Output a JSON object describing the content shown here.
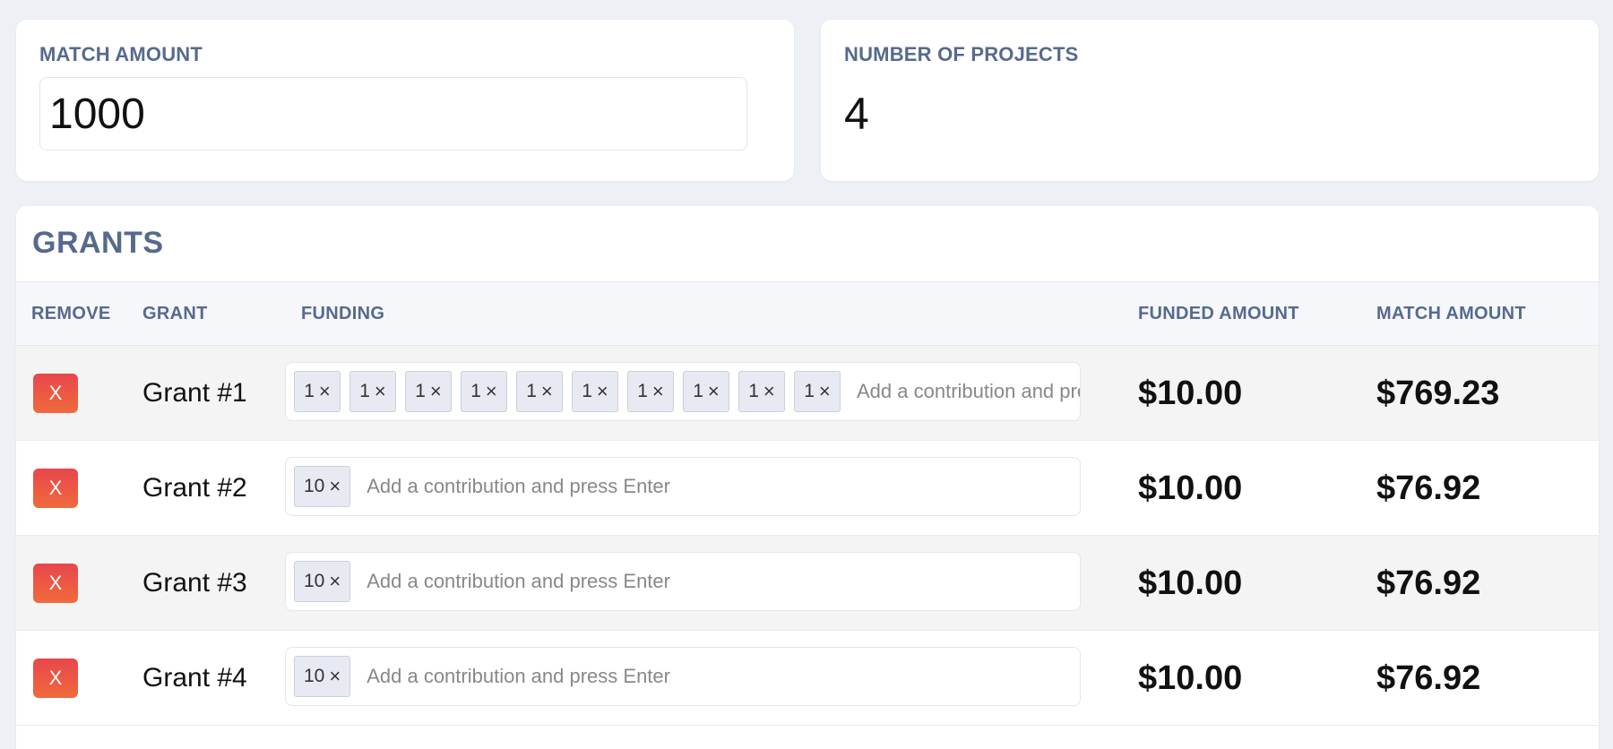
{
  "summary": {
    "match_amount_label": "MATCH AMOUNT",
    "match_amount_value": "1000",
    "num_projects_label": "NUMBER OF PROJECTS",
    "num_projects_value": "4"
  },
  "grants": {
    "title": "GRANTS",
    "columns": {
      "remove": "REMOVE",
      "grant": "GRANT",
      "funding": "FUNDING",
      "funded_amount": "FUNDED AMOUNT",
      "match_amount": "MATCH AMOUNT"
    },
    "placeholder": "Add a contribution and press Enter",
    "remove_label": "X",
    "tag_remove_glyph": "×",
    "rows": [
      {
        "name": "Grant #1",
        "contributions": [
          "1",
          "1",
          "1",
          "1",
          "1",
          "1",
          "1",
          "1",
          "1",
          "1"
        ],
        "funded": "$10.00",
        "match": "$769.23"
      },
      {
        "name": "Grant #2",
        "contributions": [
          "10"
        ],
        "funded": "$10.00",
        "match": "$76.92"
      },
      {
        "name": "Grant #3",
        "contributions": [
          "10"
        ],
        "funded": "$10.00",
        "match": "$76.92"
      },
      {
        "name": "Grant #4",
        "contributions": [
          "10"
        ],
        "funded": "$10.00",
        "match": "$76.92"
      }
    ]
  },
  "colors": {
    "label": "#566a8d",
    "remove_button_top": "#e8464c",
    "remove_button_bottom": "#f06a3c",
    "tag_bg": "#e7eaf2",
    "page_bg": "#edf0f5"
  }
}
